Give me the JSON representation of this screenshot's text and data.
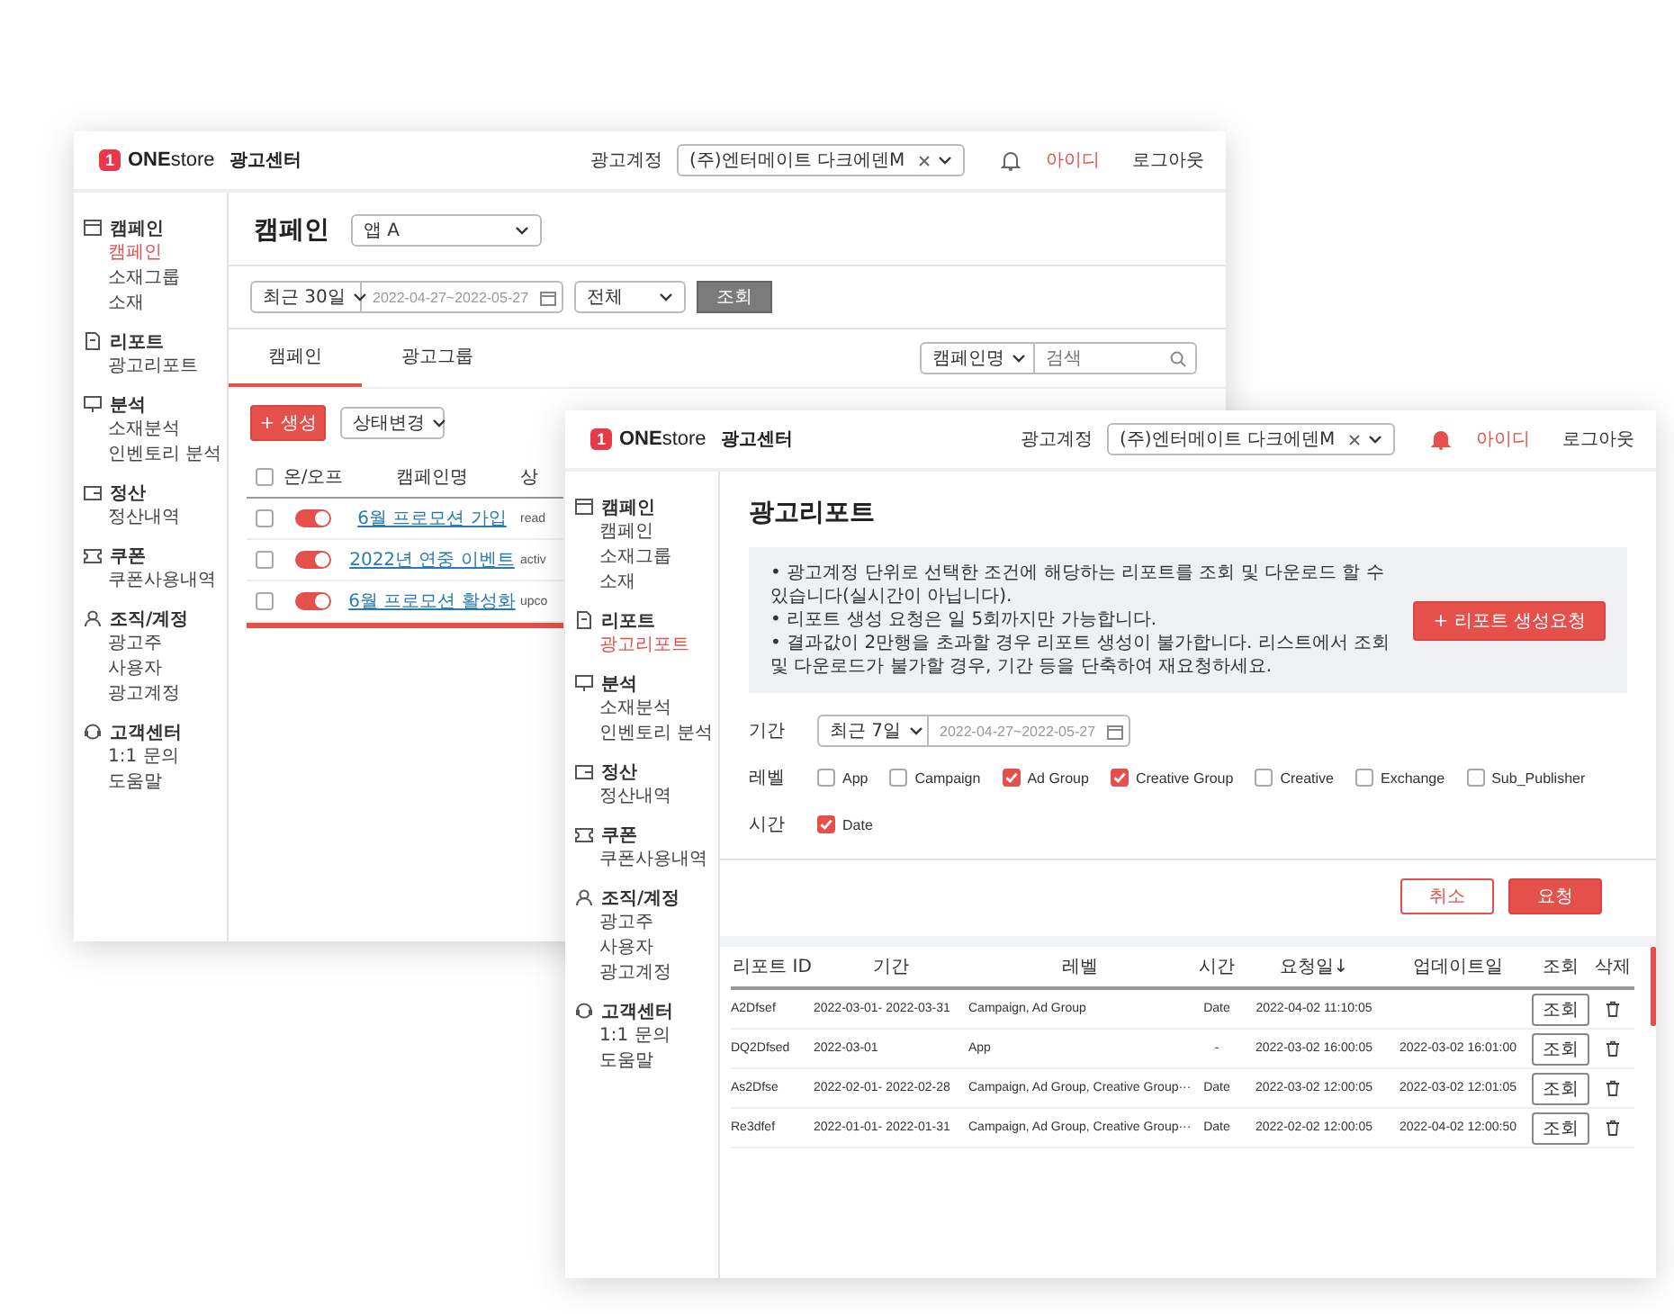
{
  "back_window": {
    "header": {
      "logo_mark": "1",
      "logo": "**ONE**store",
      "title": "광고센터",
      "account_label": "광고계정",
      "account_value": "(주)엔터메이트 다크에덴M",
      "alert": false,
      "user": "아이디",
      "logout": "로그아웃"
    },
    "sidebar": [
      {
        "label": "캠페인",
        "kind": "campaign",
        "children": [
          {
            "label": "캠페인",
            "selected": true
          },
          {
            "label": "소재그룹",
            "selected": false
          },
          {
            "label": "소재",
            "selected": false
          }
        ]
      },
      {
        "label": "리포트",
        "kind": "report",
        "children": [
          {
            "label": "광고리포트",
            "selected": false
          }
        ]
      },
      {
        "label": "분석",
        "kind": "analysis",
        "children": [
          {
            "label": "소재분석",
            "selected": false
          },
          {
            "label": "인벤토리 분석",
            "selected": false
          }
        ]
      },
      {
        "label": "정산",
        "kind": "settlement",
        "children": [
          {
            "label": "정산내역",
            "selected": false
          }
        ]
      },
      {
        "label": "쿠폰",
        "kind": "coupon",
        "children": [
          {
            "label": "쿠폰사용내역",
            "selected": false
          }
        ]
      },
      {
        "label": "조직/계정",
        "kind": "org",
        "children": [
          {
            "label": "광고주",
            "selected": false
          },
          {
            "label": "사용자",
            "selected": false
          },
          {
            "label": "광고계정",
            "selected": false
          }
        ]
      },
      {
        "label": "고객센터",
        "kind": "support",
        "children": [
          {
            "label": "1:1 문의",
            "selected": false
          },
          {
            "label": "도움말",
            "selected": false
          }
        ]
      }
    ],
    "page_title": "캠페인",
    "app_select": "앱 A",
    "filters": {
      "period": "최근 30일",
      "date_range": "2022-04-27~2022-05-27",
      "status": "전체",
      "search_button": "조회"
    },
    "tabs": [
      {
        "label": "캠페인",
        "selected": true
      },
      {
        "label": "광고그룹",
        "selected": false
      }
    ],
    "search": {
      "field": "캠페인명",
      "placeholder": "검색"
    },
    "actions": {
      "create": "+ 생성",
      "change_status": "상태변경"
    },
    "table": {
      "select_all_checked": false,
      "columns": [
        "온/오프",
        "캠페인명",
        "상"
      ],
      "rows": [
        {
          "checked": false,
          "on": true,
          "name": "6월 프로모션 가입",
          "status": "read"
        },
        {
          "checked": false,
          "on": true,
          "name": "2022년 연중 이벤트",
          "status": "activ"
        },
        {
          "checked": false,
          "on": true,
          "name": "6월 프로모션 활성화",
          "status": "upco"
        }
      ]
    }
  },
  "front_window": {
    "header": {
      "logo_mark": "1",
      "logo": "**ONE**store",
      "title": "광고센터",
      "account_label": "광고계정",
      "account_value": "(주)엔터메이트 다크에덴M",
      "alert": true,
      "user": "아이디",
      "logout": "로그아웃"
    },
    "sidebar": [
      {
        "label": "캠페인",
        "kind": "campaign",
        "children": [
          {
            "label": "캠페인",
            "selected": false
          },
          {
            "label": "소재그룹",
            "selected": false
          },
          {
            "label": "소재",
            "selected": false
          }
        ]
      },
      {
        "label": "리포트",
        "kind": "report",
        "children": [
          {
            "label": "광고리포트",
            "selected": true
          }
        ]
      },
      {
        "label": "분석",
        "kind": "analysis",
        "children": [
          {
            "label": "소재분석",
            "selected": false
          },
          {
            "label": "인벤토리 분석",
            "selected": false
          }
        ]
      },
      {
        "label": "정산",
        "kind": "settlement",
        "children": [
          {
            "label": "정산내역",
            "selected": false
          }
        ]
      },
      {
        "label": "쿠폰",
        "kind": "coupon",
        "children": [
          {
            "label": "쿠폰사용내역",
            "selected": false
          }
        ]
      },
      {
        "label": "조직/계정",
        "kind": "org",
        "children": [
          {
            "label": "광고주",
            "selected": false
          },
          {
            "label": "사용자",
            "selected": false
          },
          {
            "label": "광고계정",
            "selected": false
          }
        ]
      },
      {
        "label": "고객센터",
        "kind": "support",
        "children": [
          {
            "label": "1:1 문의",
            "selected": false
          },
          {
            "label": "도움말",
            "selected": false
          }
        ]
      }
    ],
    "page_title": "광고리포트",
    "notice": [
      "• 광고계정 단위로 선택한 조건에 해당하는 리포트를 조회 및 다운로드 할 수 있습니다(실시간이 아닙니다).",
      "• 리포트 생성 요청은 일 5회까지만 가능합니다.",
      "• 결과값이 2만행을 초과할 경우 리포트 생성이 불가합니다. 리스트에서 조회 및 다운로드가 불가할 경우, 기간 등을 단축하여 재요청하세요."
    ],
    "create_button": "+ 리포트 생성요청",
    "form": {
      "period_label": "기간",
      "period": "최근 7일",
      "date_range": "2022-04-27~2022-05-27",
      "level_label": "레벨",
      "levels": [
        {
          "label": "App",
          "checked": false
        },
        {
          "label": "Campaign",
          "checked": false
        },
        {
          "label": "Ad Group",
          "checked": true
        },
        {
          "label": "Creative Group",
          "checked": true
        },
        {
          "label": "Creative",
          "checked": false
        },
        {
          "label": "Exchange",
          "checked": false
        },
        {
          "label": "Sub_Publisher",
          "checked": false
        }
      ],
      "time_label": "시간",
      "times": [
        {
          "label": "Date",
          "checked": true
        }
      ]
    },
    "cancel_button": "취소",
    "request_button": "요청",
    "table": {
      "columns": [
        "리포트 ID",
        "기간",
        "레벨",
        "시간",
        "요청일↓",
        "업데이트일",
        "조회",
        "삭제"
      ],
      "rows": [
        {
          "id": "A2Dfsef",
          "period": "2022-03-01- 2022-03-31",
          "level": "Campaign, Ad Group",
          "time": "Date",
          "requested": "2022-04-02 11:10:05",
          "view": "조회"
        },
        {
          "id": "DQ2Dfsed",
          "period": "2022-03-01",
          "level": "App",
          "time": "-",
          "requested": "2022-03-02 16:00:05",
          "updated": "2022-03-02 16:01:00",
          "view": "조회"
        },
        {
          "id": "As2Dfse",
          "period": "2022-02-01- 2022-02-28",
          "level": "Campaign, Ad Group, Creative Group···",
          "time": "Date",
          "requested": "2022-03-02 12:00:05",
          "updated": "2022-03-02 12:01:05",
          "view": "조회"
        },
        {
          "id": "Re3dfef",
          "period": "2022-01-01- 2022-01-31",
          "level": "Campaign, Ad Group, Creative Group···",
          "time": "Date",
          "requested": "2022-02-02 12:00:05",
          "updated": "2022-04-02 12:00:50",
          "view": "조회"
        }
      ]
    }
  }
}
